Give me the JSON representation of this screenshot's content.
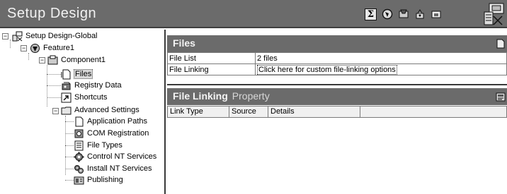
{
  "app": {
    "title": "Setup Design"
  },
  "toolbar": {
    "icons": [
      "sigma-icon",
      "globe-icon",
      "tools-icon",
      "wizard-icon",
      "window-icon"
    ],
    "sigma_glyph": "Σ"
  },
  "tree": {
    "root": "Setup Design-Global",
    "feature": "Feature1",
    "component": "Component1",
    "items": [
      "Files",
      "Registry Data",
      "Shortcuts"
    ],
    "advanced": "Advanced Settings",
    "advanced_items": [
      "Application Paths",
      "COM Registration",
      "File Types",
      "Control NT Services",
      "Install NT Services",
      "Publishing"
    ],
    "selected": "Files"
  },
  "files_panel": {
    "title": "Files",
    "rows": [
      {
        "key": "File List",
        "value": "2 files"
      },
      {
        "key": "File Linking",
        "value": "Click here for custom file-linking options"
      }
    ]
  },
  "linking_panel": {
    "title": "File Linking",
    "subtitle": "Property",
    "columns": [
      "Link Type",
      "Source",
      "Details"
    ]
  },
  "colors": {
    "header_bg": "#6b6b6b",
    "header_text": "#f2f2f2",
    "border": "#3a3a3a"
  }
}
